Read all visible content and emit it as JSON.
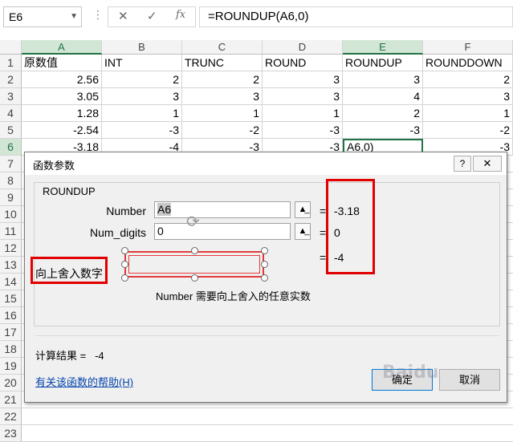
{
  "formula_bar": {
    "name_box": "E6",
    "cancel_glyph": "✕",
    "enter_glyph": "✓",
    "fx_glyph": "fx",
    "formula": "=ROUNDUP(A6,0)"
  },
  "columns": [
    "A",
    "B",
    "C",
    "D",
    "E",
    "F"
  ],
  "rows": [
    "1",
    "2",
    "3",
    "4",
    "5",
    "6",
    "7",
    "8",
    "9",
    "10",
    "11",
    "12",
    "13",
    "14",
    "15",
    "16",
    "17",
    "18",
    "19",
    "20",
    "21",
    "22",
    "23"
  ],
  "sheet": {
    "header": [
      "原数值",
      "INT",
      "TRUNC",
      "ROUND",
      "ROUNDUP",
      "ROUNDDOWN"
    ],
    "data": [
      [
        "2.56",
        "2",
        "2",
        "3",
        "3",
        "2"
      ],
      [
        "3.05",
        "3",
        "3",
        "3",
        "4",
        "3"
      ],
      [
        "1.28",
        "1",
        "1",
        "1",
        "2",
        "1"
      ],
      [
        "-2.54",
        "-3",
        "-2",
        "-3",
        "-3",
        "-2"
      ],
      [
        "-3.18",
        "-4",
        "-3",
        "-3",
        "A6,0)",
        "-3"
      ]
    ]
  },
  "dialog": {
    "title": "函数参数",
    "help_glyph": "?",
    "close_glyph": "✕",
    "function_name": "ROUNDUP",
    "args": [
      {
        "label": "Number",
        "value": "A6",
        "result": "-3.18"
      },
      {
        "label": "Num_digits",
        "value": "0",
        "result": "0"
      }
    ],
    "equals": "=",
    "result_value": "-4",
    "description": "向上舍入数字",
    "arg_description": "Number  需要向上舍入的任意实数",
    "calc_result_label": "计算结果 =",
    "calc_result_value": "-4",
    "help_link": "有关该函数的帮助(H)",
    "ok_label": "确定",
    "cancel_label": "取消"
  },
  "watermark": "Baidu",
  "colors": {
    "excel_green": "#217346",
    "highlight_red": "#e00000",
    "link_blue": "#0645ad"
  }
}
